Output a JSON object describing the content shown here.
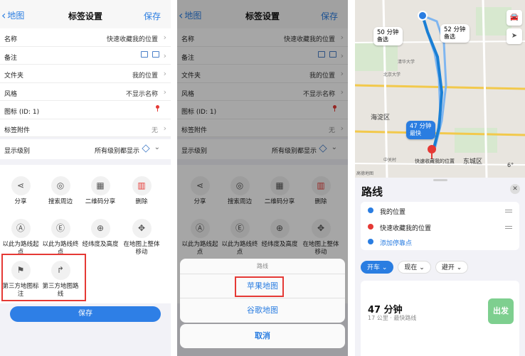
{
  "settings": {
    "back_label": "地图",
    "title": "标签设置",
    "save_label": "保存",
    "rows": [
      {
        "label": "名称",
        "value": "快速收藏我的位置"
      },
      {
        "label": "备注",
        "value": ""
      },
      {
        "label": "文件夹",
        "value": "我的位置"
      },
      {
        "label": "风格",
        "value": "不显示名称"
      },
      {
        "label": "图标 (ID: 1)",
        "value": ""
      },
      {
        "label": "标签附件",
        "value": "无"
      }
    ],
    "level": {
      "label": "显示级别",
      "value": "所有级别都显示"
    },
    "actions": [
      {
        "label": "分享"
      },
      {
        "label": "搜索周边"
      },
      {
        "label": "二维码分享"
      },
      {
        "label": "删除"
      },
      {
        "label": "以此为路线起点"
      },
      {
        "label": "以此为路线终点"
      },
      {
        "label": "经纬度及高度"
      },
      {
        "label": "在地图上整体移动"
      },
      {
        "label": "第三方地图标注"
      },
      {
        "label": "第三方地图路线"
      }
    ],
    "save_button": "保存"
  },
  "sheet": {
    "header": "路线",
    "options": [
      "苹果地图",
      "谷歌地图"
    ],
    "cancel": "取消"
  },
  "maps_app": {
    "bubbles": [
      {
        "time": "50 分钟",
        "sub": "备选"
      },
      {
        "time": "52 分钟",
        "sub": "备选"
      },
      {
        "time": "47 分钟",
        "sub": "最快"
      }
    ],
    "map_labels": {
      "district1": "海淀区",
      "district2": "东城区",
      "dest": "快速收藏我的位置",
      "school1": "清华大学",
      "school2": "北京大学",
      "park": "中关村",
      "brand": "高德地图",
      "temp": "6°"
    },
    "panel_title": "路线",
    "stops": [
      "我的位置",
      "快速收藏我的位置",
      "添加停靠点"
    ],
    "chips": [
      "开车",
      "现在",
      "避开"
    ],
    "result": {
      "duration": "47 分钟",
      "meta": "17 公里 · 最快路线",
      "go": "出发"
    }
  }
}
